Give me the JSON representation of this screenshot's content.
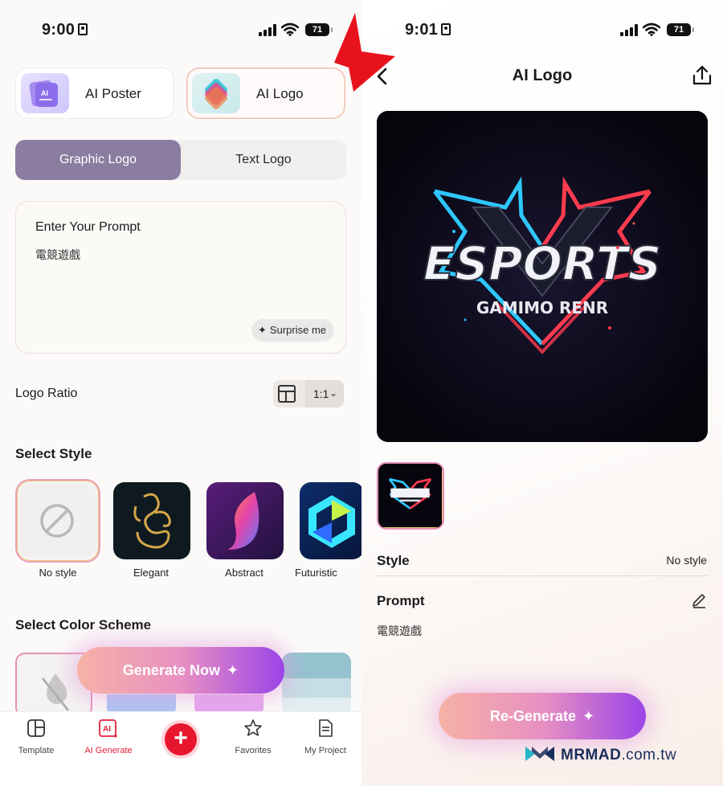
{
  "left": {
    "status": {
      "time": "9:00",
      "battery": "71"
    },
    "modes": [
      {
        "label": "AI Poster"
      },
      {
        "label": "AI Logo"
      }
    ],
    "segment": {
      "graphic": "Graphic Logo",
      "text": "Text Logo"
    },
    "prompt": {
      "title": "Enter Your Prompt",
      "value": "電競遊戲",
      "surprise": "Surprise me"
    },
    "logo_ratio": {
      "label": "Logo Ratio",
      "value": "1:1"
    },
    "style_section": "Select Style",
    "styles": [
      {
        "label": "No style"
      },
      {
        "label": "Elegant"
      },
      {
        "label": "Abstract"
      },
      {
        "label": "Futuristic"
      }
    ],
    "color_section": "Select Color Scheme",
    "generate_button": "Generate Now",
    "tabs": [
      {
        "label": "Template"
      },
      {
        "label": "AI Generate"
      },
      {
        "label": "Favorites"
      },
      {
        "label": "My Project"
      }
    ]
  },
  "right": {
    "status": {
      "time": "9:01",
      "battery": "71"
    },
    "title": "AI Logo",
    "logo_image": {
      "main_text": "ESPORTS",
      "sub_text": "GAMIMO RENR"
    },
    "style_label": "Style",
    "style_value": "No style",
    "prompt_label": "Prompt",
    "prompt_value": "電競遊戲",
    "regenerate_button": "Re-Generate"
  },
  "watermark": {
    "brand": "MRMAD",
    "domain": ".com.tw"
  },
  "colors": {
    "accent_red": "#e8152f",
    "segment_active": "#8b7da0",
    "button_gradient_start": "#f6b2a6",
    "button_gradient_end": "#9a44e8"
  }
}
